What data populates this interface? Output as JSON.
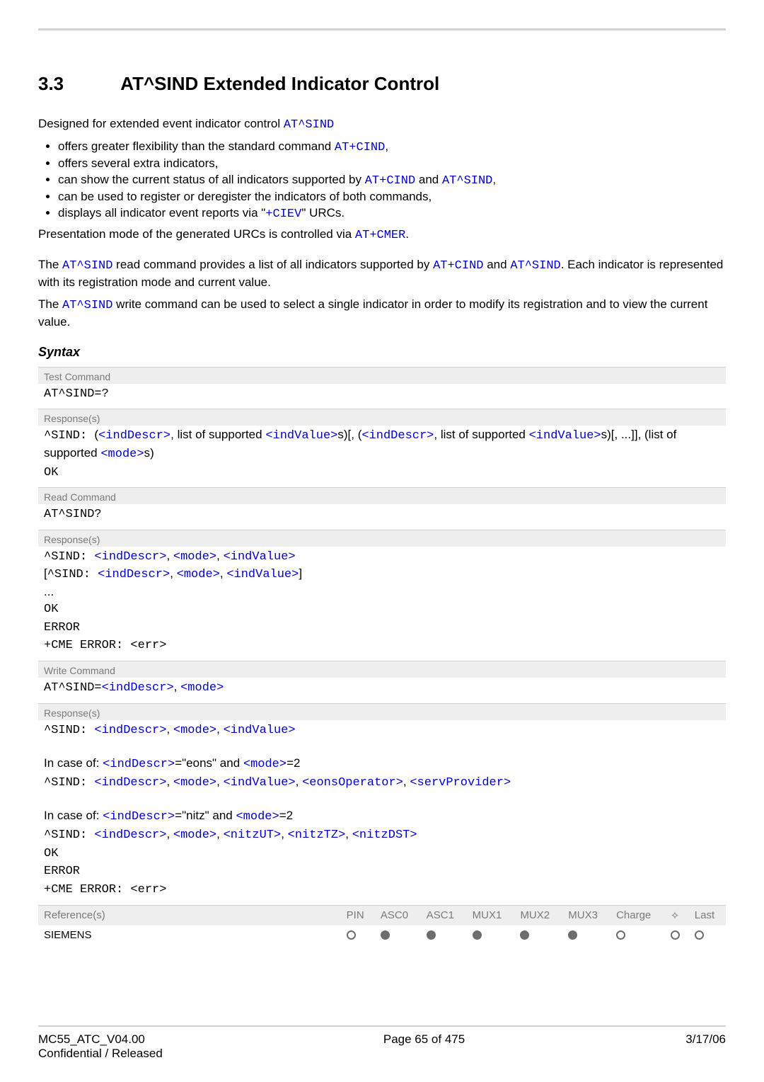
{
  "section": {
    "number": "3.3",
    "title": "AT^SIND   Extended Indicator Control"
  },
  "intro": {
    "lead": "Designed for extended event indicator control ",
    "lead_code": "AT^SIND",
    "bullets": [
      {
        "pre": "offers greater flexibility than the standard command ",
        "code": "AT+CIND",
        "post": ","
      },
      {
        "pre": "offers several extra indicators,",
        "code": "",
        "post": ""
      },
      {
        "pre": "can show the current status of all indicators supported by ",
        "code": "AT+CIND",
        "mid": " and ",
        "code2": "AT^SIND",
        "post": ","
      },
      {
        "pre": "can be used to register or deregister the indicators of both commands,",
        "code": "",
        "post": ""
      },
      {
        "pre": "displays all indicator event reports via \"",
        "code": "+CIEV",
        "post": "\" URCs."
      }
    ],
    "presentation_pre": "Presentation mode of the generated URCs is controlled via ",
    "presentation_code": "AT+CMER",
    "presentation_post": ".",
    "para2_a": "The ",
    "para2_b": "AT^SIND",
    "para2_c": " read command provides a list of all indicators supported by ",
    "para2_d": "AT+CIND",
    "para2_e": " and ",
    "para2_f": "AT^SIND",
    "para2_g": ". Each indicator is represented with its registration mode and current value.",
    "para3_a": "The ",
    "para3_b": "AT^SIND",
    "para3_c": " write command can be used to select a single indicator in order to modify its registration and to view the current value."
  },
  "syntax_label": "Syntax",
  "labels": {
    "test_command": "Test Command",
    "read_command": "Read Command",
    "write_command": "Write Command",
    "response": "Response(s)",
    "references": "Reference(s)"
  },
  "tokens": {
    "indDescr": "<indDescr>",
    "indValue": "<indValue>",
    "mode": "<mode>",
    "eonsOperator": "<eonsOperator>",
    "servProvider": "<servProvider>",
    "nitzUT": "<nitzUT>",
    "nitzTZ": "<nitzTZ>",
    "nitzDST": "<nitzDST>"
  },
  "test": {
    "cmd": "AT^SIND=?",
    "resp_pre": "^SIND: ",
    "open": "(",
    "sep": ", ",
    "lst_txt": "list of supported ",
    "s_close": "s)",
    "between": "[, (",
    "close_seq": "s)[, ...]], (list of supported ",
    "mode_close": "s)",
    "ok": "OK"
  },
  "read": {
    "cmd": "AT^SIND?",
    "l1a": "^SIND: ",
    "l2a": "[^SIND: ",
    "l2end": "]",
    "ellipsis": "...",
    "ok": "OK",
    "error": "ERROR",
    "cme": "+CME ERROR: <err>"
  },
  "write": {
    "cmd_pre": "AT^SIND=",
    "resp1_pre": "^SIND: ",
    "case1_a": "In case of: ",
    "case1_b": "=\"eons\" and ",
    "case1_c": "=2",
    "case2_a": "In case of: ",
    "case2_b": "=\"nitz\" and ",
    "case2_c": "=2",
    "ok": "OK",
    "error": "ERROR",
    "cme": "+CME ERROR: <err>"
  },
  "ref_table": {
    "headers": [
      "PIN",
      "ASC0",
      "ASC1",
      "MUX1",
      "MUX2",
      "MUX3",
      "Charge",
      "",
      "Last"
    ],
    "row_label": "SIEMENS",
    "dots": [
      "open",
      "solid",
      "solid",
      "solid",
      "solid",
      "solid",
      "open",
      "open",
      "open"
    ]
  },
  "footer": {
    "left1": "MC55_ATC_V04.00",
    "left2": "Confidential / Released",
    "center": "Page 65 of 475",
    "right": "3/17/06"
  }
}
